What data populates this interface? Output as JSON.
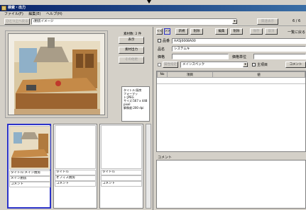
{
  "window": {
    "title": "検索・出力"
  },
  "menu": [
    "ファイル(F)",
    "編集(E)",
    "ヘルプ(H)"
  ],
  "toolbar": {
    "back_label": "ひとつ上へ戻る",
    "path": "/厨房イメージ",
    "search_label": "関連表示",
    "paging": "6 / 6",
    "list_label": "一覧に戻る"
  },
  "left": {
    "count": "素材数: 2 件",
    "display": "表示",
    "output": "素材出力",
    "other": "その他更",
    "info": [
      "タイトル:厨房",
      "フォーマット:JPEG",
      "サイズ:567 x 448 pixel",
      "解像度:200 dpi"
    ]
  },
  "thumbs": [
    {
      "title": "タイトル:メイン厨房",
      "sub": "メイン厨房",
      "comment": "コメント"
    },
    {
      "title": "タイトル",
      "sub": "オフィス厨房",
      "comment": "コメント"
    },
    {
      "title": "タイトル",
      "sub": "",
      "comment": "コメント"
    }
  ],
  "right": {
    "tabs": [
      "新規",
      "削除",
      "編集",
      "削除",
      "保存",
      "取消"
    ],
    "code_label": "品番",
    "code": "AA5J0008A00",
    "name_label": "品名",
    "name": "システムキ",
    "price_label": "価格",
    "unit_label": "価格単位",
    "attr_label": "属性指定",
    "spec": "メインスペック",
    "main_label": "主項目",
    "comment_btn": "コメント",
    "cols": [
      "No",
      "項目",
      "値"
    ],
    "comment_label": "コメント"
  }
}
